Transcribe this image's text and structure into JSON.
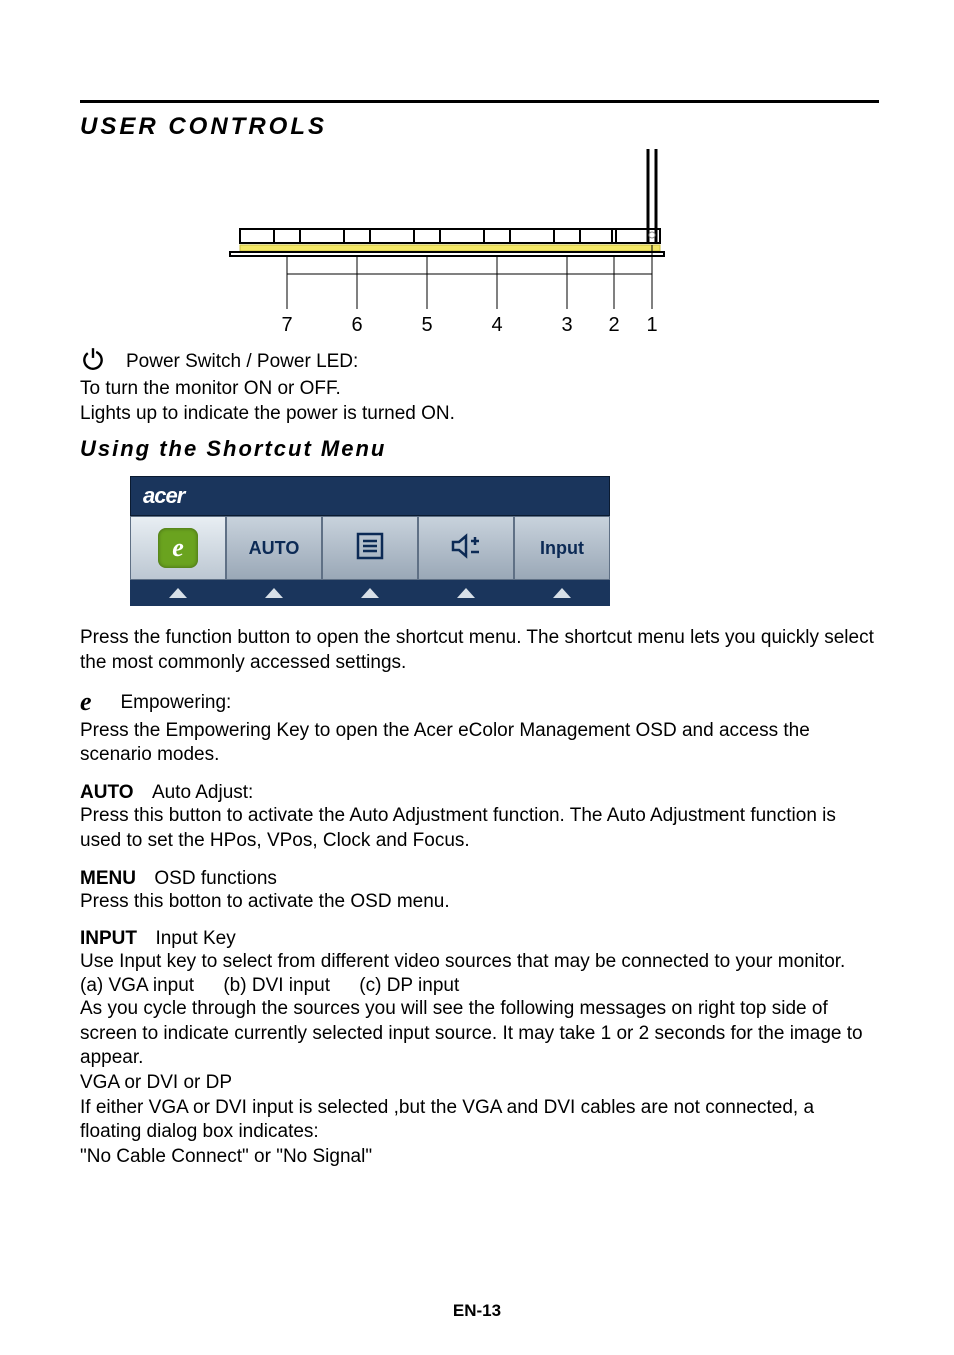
{
  "section_title": "USER CONTROLS",
  "diagram": {
    "labels": [
      "7",
      "6",
      "5",
      "4",
      "3",
      "2",
      "1"
    ]
  },
  "power": {
    "heading": "Power Switch / Power LED:",
    "line1": "To turn the monitor ON or OFF.",
    "line2": "Lights up to indicate the power is turned ON."
  },
  "subsection_title": "Using  the Shortcut Menu",
  "osd": {
    "logo": "acer",
    "buttons": {
      "auto": "AUTO",
      "input": "Input"
    }
  },
  "shortcut_intro": "Press the function button to open the shortcut menu. The shortcut menu lets you quickly select the most commonly accessed settings.",
  "empowering": {
    "heading": "Empowering:",
    "body": "Press the Empowering Key to open the Acer eColor Management OSD and access the scenario modes."
  },
  "auto": {
    "prefix": "AUTO",
    "heading": "Auto Adjust:",
    "body": "Press this button to activate the Auto Adjustment function. The Auto Adjustment function is used to set the HPos, VPos, Clock and Focus."
  },
  "menu": {
    "prefix": "MENU",
    "heading": "OSD functions",
    "body": "Press this botton to activate the OSD menu."
  },
  "input": {
    "prefix": "INPUT",
    "heading": "Input Key",
    "body1": "Use Input key to select from different video sources that may be connected to your monitor.",
    "options": {
      "a": "(a) VGA input",
      "b": "(b) DVI input",
      "c": "(c) DP input"
    },
    "body2": "As you cycle through the sources you will see the following messages on right top side of screen to indicate currently selected input source. It may take 1 or 2 seconds for the image to appear.",
    "body3": "VGA  or  DVI  or  DP",
    "body4": "If either VGA or DVI input is selected ,but the VGA and DVI cables are not connected, a floating dialog box indicates:",
    "body5": "\"No Cable Connect\" or \"No Signal\""
  },
  "page_number": "EN-13"
}
